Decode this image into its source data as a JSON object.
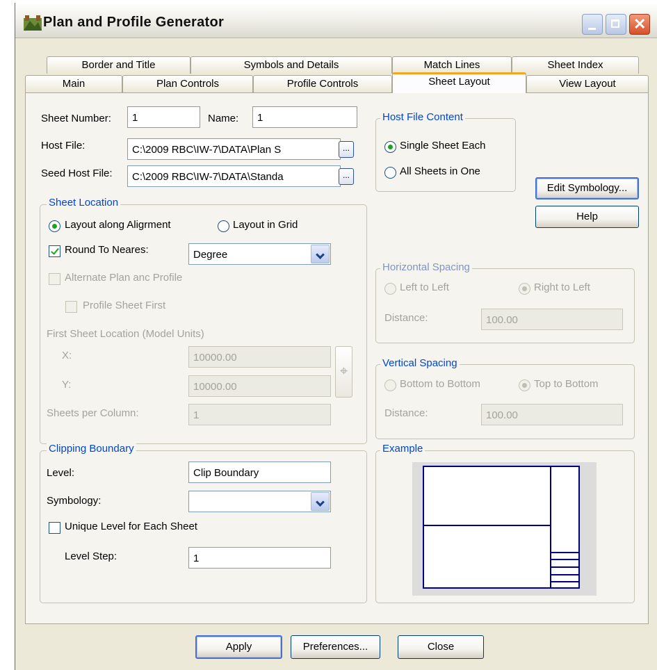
{
  "window": {
    "title": "Plan and Profile Generator",
    "accent": "#0046d5",
    "icons": {
      "app": "app-icon",
      "minimize": "minimize-icon",
      "maximize": "maximize-icon",
      "close": "close-icon"
    }
  },
  "tabs": {
    "row1": [
      "Border and Title",
      "Symbols and Details",
      "Match Lines",
      "Sheet Index"
    ],
    "row2": [
      "Main",
      "Plan Controls",
      "Profile Controls",
      "Sheet Layout",
      "View Layout"
    ],
    "active": "Sheet Layout"
  },
  "sheet": {
    "number_label": "Sheet Number:",
    "number_value": "1",
    "name_label": "Name:",
    "name_value": "1",
    "host_file_label": "Host File:",
    "host_file_value": "C:\\2009 RBC\\IW-7\\DATA\\Plan S",
    "seed_host_file_label": "Seed Host File:",
    "seed_host_file_value": "C:\\2009 RBC\\IW-7\\DATA\\Standa",
    "browse_label": "..."
  },
  "host_file_content": {
    "title": "Host File Content",
    "options": [
      "Single Sheet Each",
      "All Sheets in One"
    ],
    "selected": "Single Sheet Each"
  },
  "buttons": {
    "edit_symbology": "Edit Symbology...",
    "help": "Help",
    "apply": "Apply",
    "preferences": "Preferences...",
    "close": "Close"
  },
  "sheet_location": {
    "title": "Sheet Location",
    "layout_along": "Layout along Aligrment",
    "layout_grid": "Layout in Grid",
    "selected": "Layout along Aligrment",
    "round_to_nearest_label": "Round To Neares:",
    "round_to_nearest_checked": true,
    "round_to_nearest_value": "Degree",
    "alternate_label": "Alternate Plan anc Profile",
    "profile_first_label": "Profile Sheet First",
    "first_location_label": "First Sheet Location (Model Units)",
    "x_label": "X:",
    "x_value": "10000.00",
    "y_label": "Y:",
    "y_value": "10000.00",
    "sheets_per_column_label": "Sheets per Column:",
    "sheets_per_column_value": "1"
  },
  "horizontal_spacing": {
    "title": "Horizontal Spacing",
    "left_to_left": "Left to Left",
    "right_to_left": "Right to Left",
    "selected": "Right to Left",
    "distance_label": "Distance:",
    "distance_value": "100.00"
  },
  "vertical_spacing": {
    "title": "Vertical Spacing",
    "bottom_to_bottom": "Bottom to Bottom",
    "top_to_bottom": "Top to Bottom",
    "selected": "Top to Bottom",
    "distance_label": "Distance:",
    "distance_value": "100.00"
  },
  "clipping_boundary": {
    "title": "Clipping Boundary",
    "level_label": "Level:",
    "level_value": "Clip Boundary",
    "symbology_label": "Symbology:",
    "symbology_value": "",
    "unique_level_label": "Unique Level for Each Sheet",
    "unique_level_checked": false,
    "level_step_label": "Level Step:",
    "level_step_value": "1"
  },
  "example": {
    "title": "Example",
    "line_color": "#000080"
  }
}
